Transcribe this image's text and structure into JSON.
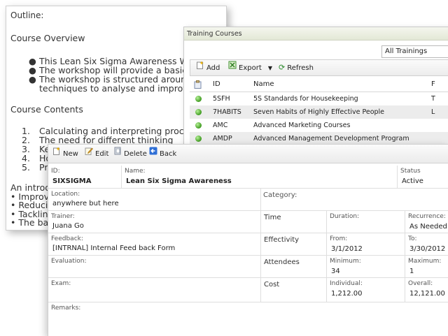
{
  "outline": {
    "title": "Outline:",
    "overview_heading": "Course Overview",
    "overview_bullets": [
      "This Lean Six Sigma Awareness Wor",
      "The workshop will provide a basic aw",
      "The workshop is structured around a"
    ],
    "overview_continuation": "techniques to analyse and improve a",
    "contents_heading": "Course Contents",
    "contents_items": [
      {
        "num": "1.",
        "text": "Calculating and interpreting process"
      },
      {
        "num": "2.",
        "text": "The need for different thinking"
      },
      {
        "num": "3.",
        "text": "Ke"
      },
      {
        "num": "4.",
        "text": "Ho"
      },
      {
        "num": "5.",
        "text": "Pr"
      }
    ],
    "intro_lines": [
      "An introdu",
      "• Improvi",
      "• Reducin",
      "• Tacklin",
      "• The bas"
    ]
  },
  "courses": {
    "title": "Training Courses",
    "filter_value": "All Trainings",
    "toolbar": {
      "add": "Add",
      "export": "Export",
      "refresh": "Refresh"
    },
    "headers": {
      "id": "ID",
      "name": "Name",
      "extra": "F"
    },
    "rows": [
      {
        "id": "5SFH",
        "name": "5S Standards for Housekeeping",
        "extra": "T"
      },
      {
        "id": "7HABITS",
        "name": "Seven Habits of Highly Effective People",
        "extra": "L"
      },
      {
        "id": "AMC",
        "name": "Advanced Marketing Courses",
        "extra": ""
      },
      {
        "id": "AMDP",
        "name": "Advanced Management Development Program",
        "extra": ""
      }
    ]
  },
  "form": {
    "toolbar": {
      "new": "New",
      "edit": "Edit",
      "delete": "Delete",
      "back": "Back"
    },
    "id_label": "ID:",
    "id_value": "SIXSIGMA",
    "name_label": "Name:",
    "name_value": "Lean Six Sigma Awareness",
    "status_label": "Status",
    "status_value": "Active",
    "location_label": "Location:",
    "location_value": "anywhere but here",
    "category_label": "Category:",
    "trainer_label": "Trainer:",
    "trainer_value": "Juana Go",
    "time_label": "Time",
    "duration_label": "Duration:",
    "recurrence_label": "Recurrence:",
    "recurrence_value": "As Needed",
    "feedback_label": "Feedback:",
    "feedback_value": "[INTRNAL] Internal Feed back Form",
    "effectivity_label": "Effectivity",
    "from_label": "From:",
    "from_value": "3/1/2012",
    "to_label": "To:",
    "to_value": "3/30/2012",
    "evaluation_label": "Evaluation:",
    "attendees_label": "Attendees",
    "minimum_label": "Minimum:",
    "minimum_value": "34",
    "maximum_label": "Maximum:",
    "maximum_value": "1",
    "exam_label": "Exam:",
    "cost_label": "Cost",
    "individual_label": "Individual:",
    "individual_value": "1,212.00",
    "overall_label": "Overall:",
    "overall_value": "12,121.00",
    "remarks_label": "Remarks:"
  }
}
